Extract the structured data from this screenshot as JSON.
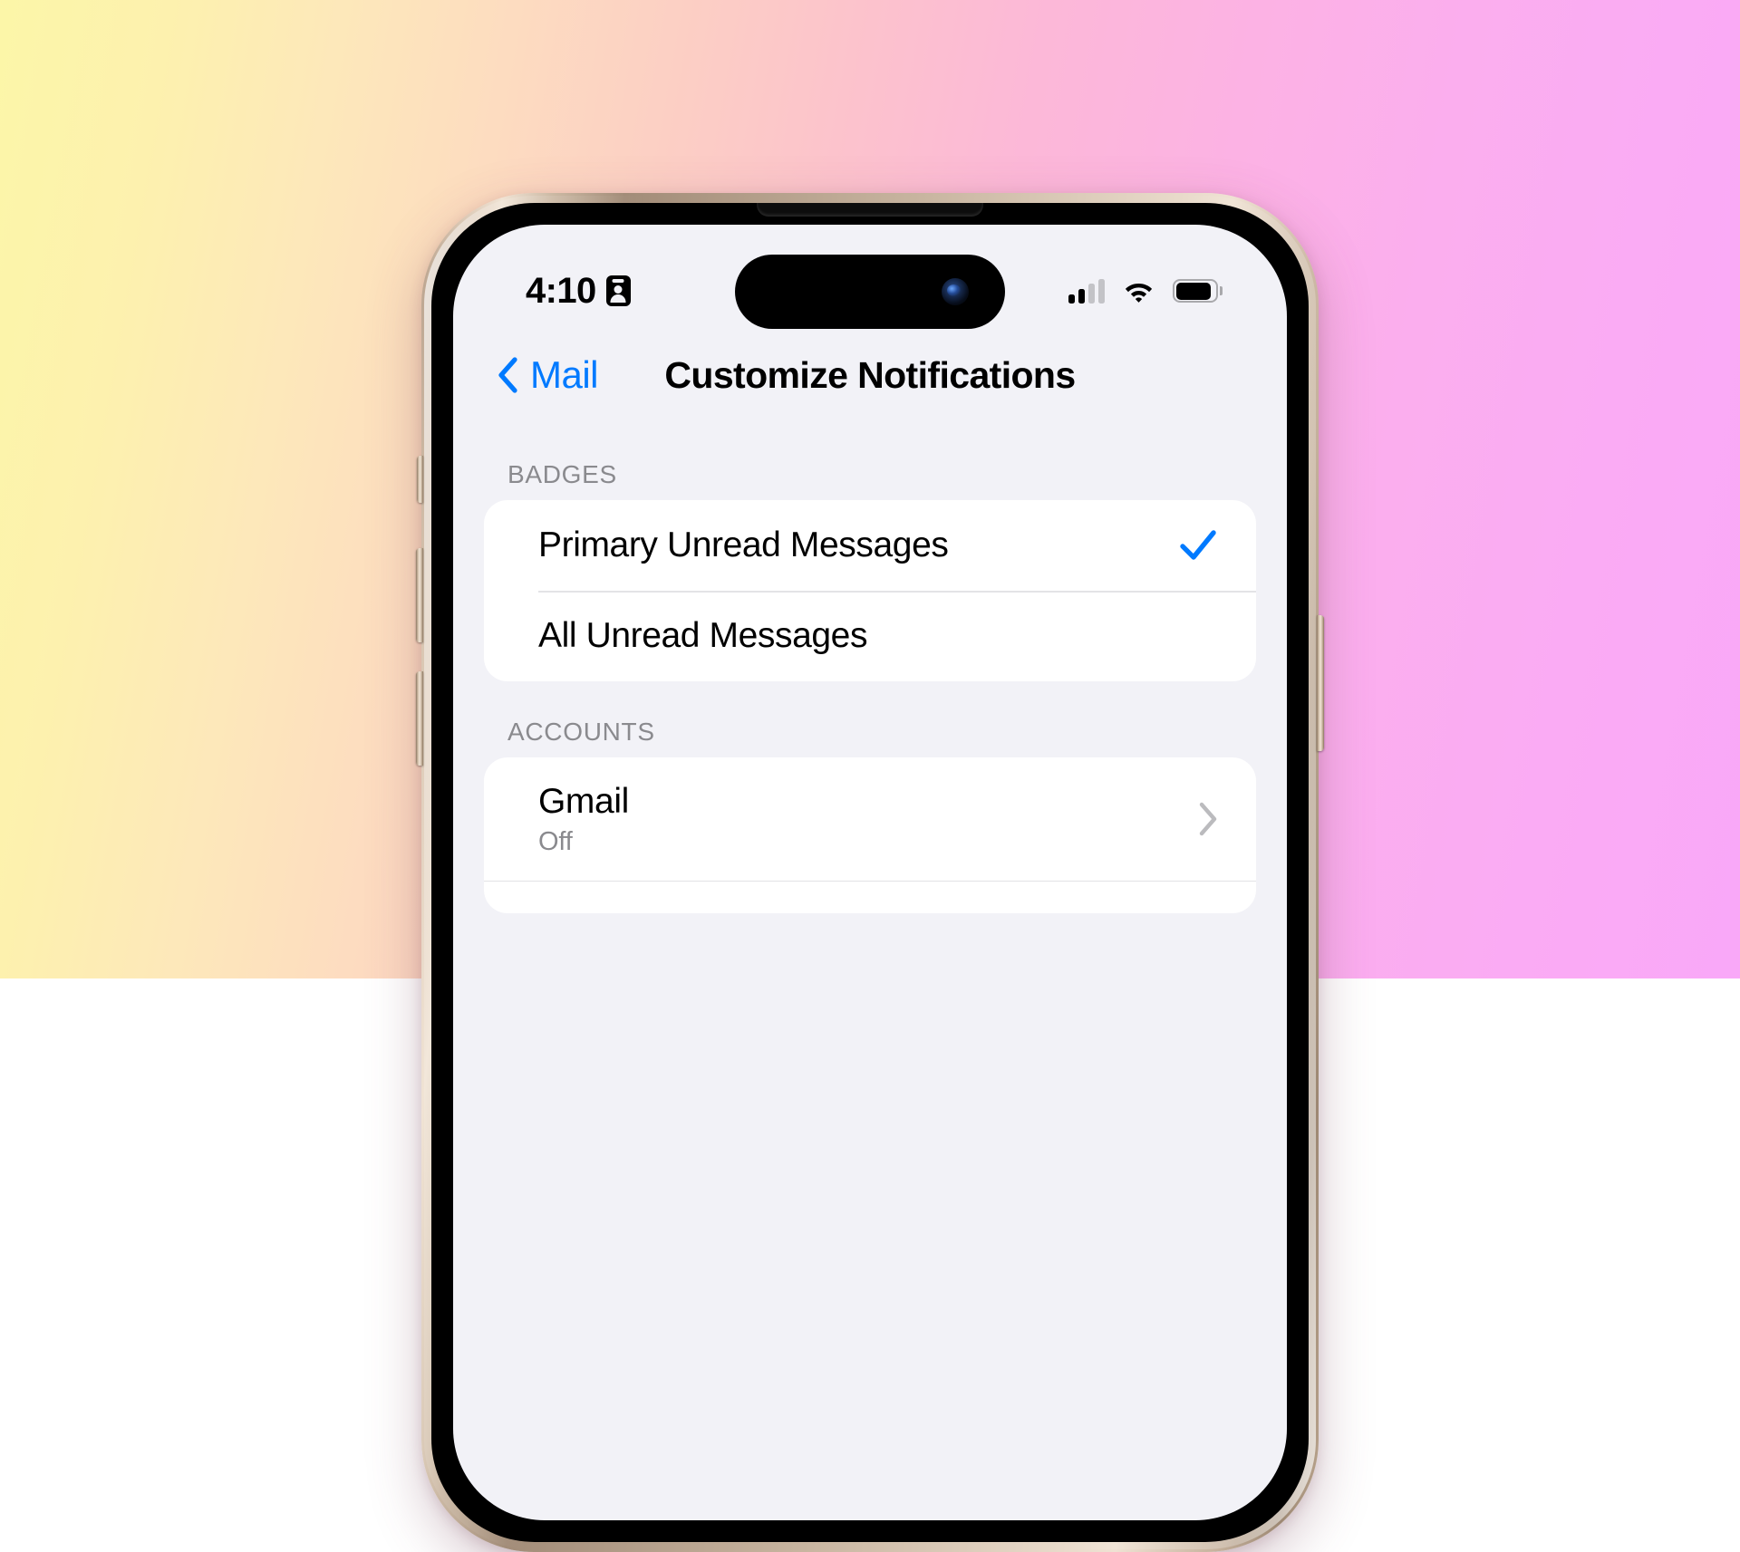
{
  "statusbar": {
    "time": "4:10",
    "id_icon": "id-card-icon",
    "cellular_icon": "cellular-signal-icon",
    "cellular_bars_filled": 2,
    "cellular_bars_total": 4,
    "wifi_icon": "wifi-icon",
    "battery_icon": "battery-icon"
  },
  "navbar": {
    "back_label": "Mail",
    "back_icon": "chevron-left-icon",
    "title": "Customize Notifications"
  },
  "sections": [
    {
      "header": "BADGES",
      "rows": [
        {
          "title": "Primary Unread Messages",
          "selected": true,
          "accessory": "checkmark"
        },
        {
          "title": "All Unread Messages",
          "selected": false,
          "accessory": "none"
        }
      ]
    },
    {
      "header": "ACCOUNTS",
      "rows": [
        {
          "title": "Gmail",
          "subtitle": "Off",
          "accessory": "chevron"
        }
      ]
    }
  ],
  "colors": {
    "accent": "#007AFF",
    "screen_bg": "#F2F2F7",
    "card_bg": "#FFFFFF",
    "secondary_text": "#8A8A8E",
    "separator": "#E3E3E6",
    "wallpaper_start": "#FCF6A8",
    "wallpaper_end": "#F9A8F8"
  }
}
